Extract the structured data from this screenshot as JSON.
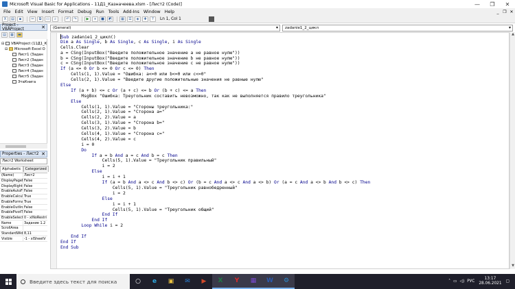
{
  "window": {
    "title": "Microsoft Visual Basic for Applications - 11Д1_Казначеева.xlsm - [Лист2 (Code)]",
    "min": "—",
    "max": "❐",
    "close": "✕"
  },
  "menu": {
    "items": [
      "File",
      "Edit",
      "View",
      "Insert",
      "Format",
      "Debug",
      "Run",
      "Tools",
      "Add-Ins",
      "Window",
      "Help"
    ],
    "right": [
      "_",
      "❐",
      "✕"
    ]
  },
  "toolbar": {
    "position": "Ln 1, Col 1"
  },
  "project": {
    "title": "Project - VBAProject",
    "close": "✕",
    "tree": [
      {
        "label": "VBAProject (11Д1_К",
        "indent": 0,
        "exp": "⊟",
        "type": "proj"
      },
      {
        "label": "Microsoft Excel O",
        "indent": 1,
        "exp": "⊟",
        "type": "folder"
      },
      {
        "label": "Лист1 (Задан",
        "indent": 2,
        "exp": "",
        "type": "sheet"
      },
      {
        "label": "Лист2 (Задан",
        "indent": 2,
        "exp": "",
        "type": "sheet"
      },
      {
        "label": "Лист3 (Задан",
        "indent": 2,
        "exp": "",
        "type": "sheet"
      },
      {
        "label": "Лист4 (Задан",
        "indent": 2,
        "exp": "",
        "type": "sheet"
      },
      {
        "label": "Лист5 (Задан",
        "indent": 2,
        "exp": "",
        "type": "sheet"
      },
      {
        "label": "ЭтаКнига",
        "indent": 2,
        "exp": "",
        "type": "sheet"
      }
    ]
  },
  "properties": {
    "title": "Properties - Лист2",
    "close": "✕",
    "object": "Лист2 Worksheet",
    "tabs": [
      "Alphabetic",
      "Categorized"
    ],
    "rows": [
      [
        "(Name)",
        "Лист2"
      ],
      [
        "DisplayPageBr",
        "False"
      ],
      [
        "DisplayRightTo",
        "False"
      ],
      [
        "EnableAutoFilt",
        "False"
      ],
      [
        "EnableCalculat",
        "True"
      ],
      [
        "EnableFormatC",
        "True"
      ],
      [
        "EnableOutlinin",
        "False"
      ],
      [
        "EnablePivotTal",
        "False"
      ],
      [
        "EnableSelectio",
        "0 - xlNoRestri"
      ],
      [
        "Name",
        "Задание 1.2"
      ],
      [
        "ScrollArea",
        ""
      ],
      [
        "StandardWidth",
        "8,11"
      ],
      [
        "Visible",
        "-1 - xlSheetV"
      ]
    ]
  },
  "editor": {
    "object": "(General)",
    "procedure": "zadanie1_2_цикл",
    "lines": [
      "Sub zadanie1_2_цикл()",
      "Dim a As Single, b As Single, c As Single, i As Single",
      "Cells.Clear",
      "a = CSng(InputBox(\"Введите положительное значение a не равное нулю\"))",
      "b = CSng(InputBox(\"Введите положительное значение b не равное нулю\"))",
      "c = CSng(InputBox(\"Введите положительное значение c не равное нулю\"))",
      "If (a <= 0 Or b <= 0 Or c <= 0) Then",
      "    Cells(1, 1).Value = \"Ошибка: a<=0 или b<=0 или c<=0\"",
      "    Cells(2, 1).Value = \"Введите другие положительные значения не равные нулю\"",
      "Else",
      "    If (a + b) <= c Or (a + c) <= b Or (b + c) <= a Then",
      "        MsgBox \"Ошибка: Треугольник составить невозможно, так как не выполняется правило треугольника\"",
      "    Else",
      "        Cells(1, 1).Value = \"Стороны треугольника:\"",
      "        Cells(2, 1).Value = \"Сторона a=\"",
      "        Cells(2, 2).Value = a",
      "        Cells(3, 1).Value = \"Сторона b=\"",
      "        Cells(3, 2).Value = b",
      "        Cells(4, 1).Value = \"Сторона c=\"",
      "        Cells(4, 2).Value = c",
      "        i = 0",
      "        Do",
      "            If a = b And a = c And b = c Then",
      "                Cells(5, 1).Value = \"Треугольник правильный\"",
      "                i = 2",
      "            Else",
      "                i = i + 1",
      "                If (a = b And a <> c And b <> c) Or (b = c And a <> c And a <> b) Or (a = c And a <> b And b <> c) Then",
      "                    Cells(5, 1).Value = \"Треугольник равнобедренный\"",
      "                    i = 2",
      "                Else",
      "                    i = i + 1",
      "                    Cells(5, 1).Value = \"Треугольник общий\"",
      "                End If",
      "            End If",
      "        Loop While i = 2",
      "",
      "    End If",
      "End If",
      "End Sub"
    ]
  },
  "taskbar": {
    "search_placeholder": "Введите здесь текст для поиска",
    "apps": [
      "○",
      "e",
      "▣",
      "✉",
      "▶",
      "X",
      "Y",
      "▦",
      "W",
      "⚙"
    ],
    "lang": "РУС",
    "time": "13:17",
    "date": "28.06.2021"
  }
}
